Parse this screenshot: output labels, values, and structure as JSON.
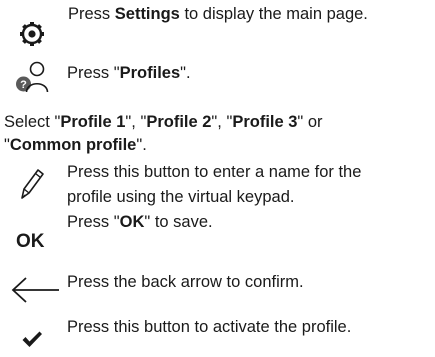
{
  "steps": {
    "settings": {
      "icon": "settings-gear-icon",
      "pre": "Press ",
      "bold": "Settings",
      "post": " to display the main page."
    },
    "profiles": {
      "icon": "profiles-user-icon",
      "pre": "Press \"",
      "bold": "Profiles",
      "post": "\"."
    },
    "select": {
      "pre": "Select \"",
      "p1": "Profile 1",
      "sep1": "\", \"",
      "p2": "Profile 2",
      "sep2": "\", \"",
      "p3": "Profile 3",
      "sep3": "\" or",
      "open2": "\"",
      "common": "Common profile",
      "close2": "\"."
    },
    "rename": {
      "icon": "pencil-icon",
      "line1": "Press this button to enter a name for the",
      "line2": "profile using the virtual keypad."
    },
    "ok": {
      "icon": "ok-text-icon",
      "icon_text": "OK",
      "pre": "Press \"",
      "bold": "OK",
      "post": "\" to save."
    },
    "back": {
      "icon": "back-arrow-icon",
      "text": "Press the back arrow to confirm."
    },
    "activate": {
      "icon": "checkmark-icon",
      "text": "Press this button to activate the profile."
    }
  },
  "colors": {
    "text": "#1a1a1a",
    "icon": "#1a1a1a",
    "badge_fill": "#5a5a5a"
  }
}
